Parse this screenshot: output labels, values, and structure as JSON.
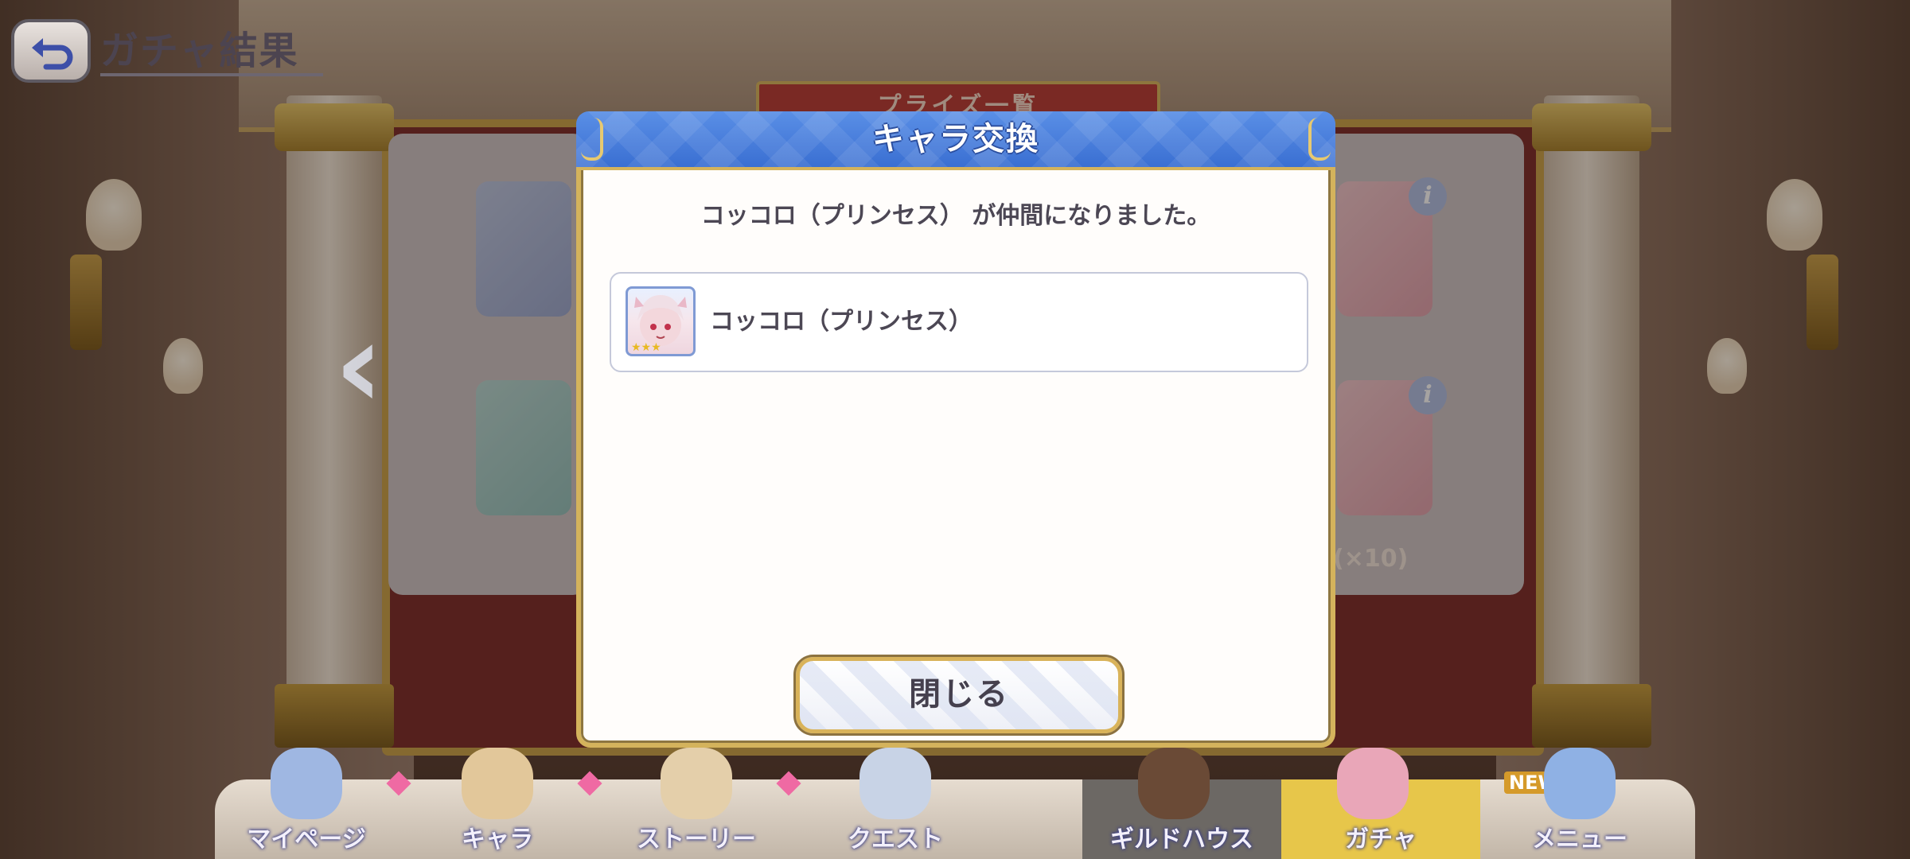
{
  "screen": {
    "title": "ガチャ結果",
    "prize_banner": "プライズ一覧",
    "prize_count": "(×10)"
  },
  "modal": {
    "title": "キャラ交換",
    "message": "コッコロ（プリンセス） が仲間になりました。",
    "character": {
      "name": "コッコロ（プリンセス）",
      "stars": 3
    },
    "close_label": "閉じる"
  },
  "bottom_nav": {
    "items": [
      {
        "label": "マイページ"
      },
      {
        "label": "キャラ"
      },
      {
        "label": "ストーリー"
      },
      {
        "label": "クエスト"
      },
      {
        "label": "ギルドハウス"
      },
      {
        "label": "ガチャ"
      },
      {
        "label": "メニュー"
      }
    ],
    "new_badge": "NEW"
  },
  "colors": {
    "header_blue": "#3a6fd2",
    "gold_border": "#d4b35c",
    "text_dark": "#4c4754"
  }
}
